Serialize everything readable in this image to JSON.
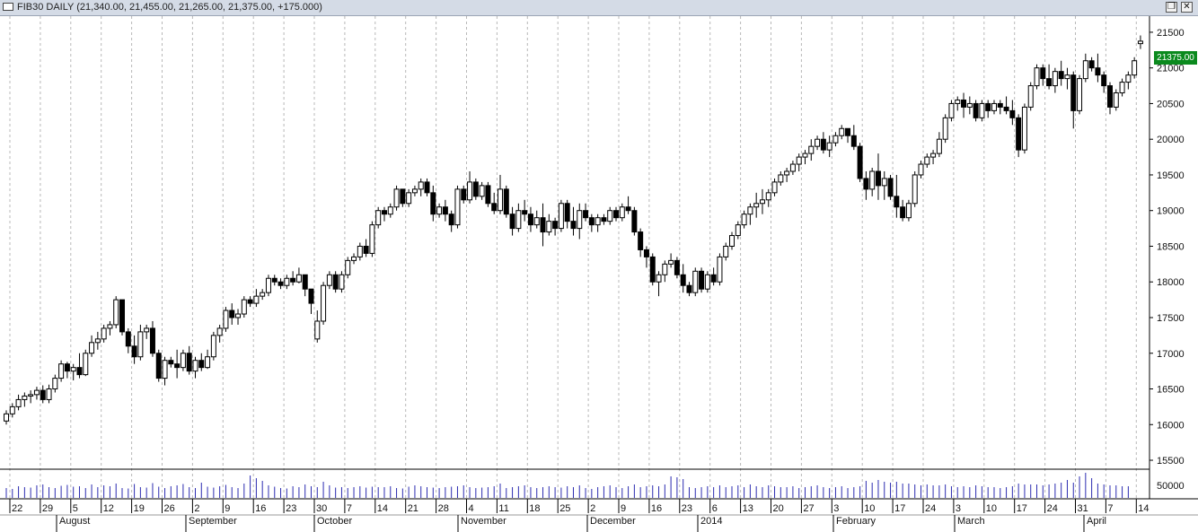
{
  "window": {
    "title": "FIB30 DAILY (21,340.00, 21,455.00, 21,265.00, 21,375.00, +175.000)",
    "restore_icon": "restore-icon",
    "close_icon": "close-icon"
  },
  "last_price_label": "21375.00",
  "colors": {
    "up_fill": "#ffffff",
    "down_fill": "#000000",
    "volume": "#2b2bb0",
    "grid": "#b8b8b8",
    "last_badge": "#0b8a1e"
  },
  "chart_data": {
    "type": "candlestick",
    "price_axis": {
      "ylim": [
        15450,
        21650
      ],
      "ticks": [
        15500,
        16000,
        16500,
        17000,
        17500,
        18000,
        18500,
        19000,
        19500,
        20000,
        20500,
        21000,
        21500
      ]
    },
    "volume_axis": {
      "ticks": [
        50000
      ]
    },
    "x_ticks": [
      "22",
      "29",
      "5",
      "12",
      "19",
      "26",
      "2",
      "9",
      "16",
      "23",
      "30",
      "7",
      "14",
      "21",
      "28",
      "4",
      "11",
      "18",
      "25",
      "2",
      "9",
      "16",
      "23",
      "6",
      "13",
      "20",
      "27",
      "3",
      "10",
      "17",
      "24",
      "3",
      "10",
      "17",
      "24",
      "31",
      "7",
      "14"
    ],
    "months": [
      "August",
      "September",
      "October",
      "November",
      "December",
      "2014",
      "February",
      "March",
      "April"
    ],
    "grid": true,
    "candles": [
      [
        16050,
        16200,
        16000,
        16150
      ],
      [
        16150,
        16300,
        16100,
        16250
      ],
      [
        16250,
        16420,
        16200,
        16350
      ],
      [
        16350,
        16450,
        16250,
        16400
      ],
      [
        16400,
        16480,
        16300,
        16420
      ],
      [
        16420,
        16530,
        16350,
        16480
      ],
      [
        16480,
        16550,
        16300,
        16350
      ],
      [
        16350,
        16560,
        16300,
        16500
      ],
      [
        16500,
        16700,
        16450,
        16650
      ],
      [
        16650,
        16900,
        16600,
        16850
      ],
      [
        16850,
        16880,
        16650,
        16750
      ],
      [
        16750,
        16850,
        16620,
        16800
      ],
      [
        16800,
        17000,
        16650,
        16700
      ],
      [
        16700,
        17050,
        16680,
        17000
      ],
      [
        17000,
        17250,
        16950,
        17150
      ],
      [
        17150,
        17300,
        17050,
        17200
      ],
      [
        17200,
        17400,
        17150,
        17350
      ],
      [
        17350,
        17450,
        17250,
        17400
      ],
      [
        17400,
        17800,
        17350,
        17750
      ],
      [
        17750,
        17750,
        17250,
        17300
      ],
      [
        17300,
        17350,
        17000,
        17100
      ],
      [
        17100,
        17250,
        16850,
        16950
      ],
      [
        16950,
        17400,
        16900,
        17300
      ],
      [
        17300,
        17400,
        17200,
        17350
      ],
      [
        17350,
        17450,
        16950,
        17000
      ],
      [
        17000,
        17050,
        16600,
        16650
      ],
      [
        16650,
        16950,
        16550,
        16900
      ],
      [
        16900,
        16950,
        16800,
        16850
      ],
      [
        16850,
        17050,
        16650,
        16800
      ],
      [
        16800,
        17050,
        16750,
        17000
      ],
      [
        17000,
        17100,
        16700,
        16750
      ],
      [
        16750,
        16950,
        16650,
        16900
      ],
      [
        16900,
        17000,
        16750,
        16800
      ],
      [
        16800,
        17050,
        16780,
        16950
      ],
      [
        16950,
        17300,
        16900,
        17250
      ],
      [
        17250,
        17400,
        17150,
        17350
      ],
      [
        17350,
        17650,
        17300,
        17600
      ],
      [
        17600,
        17700,
        17400,
        17500
      ],
      [
        17500,
        17620,
        17400,
        17550
      ],
      [
        17550,
        17800,
        17500,
        17750
      ],
      [
        17750,
        17800,
        17650,
        17700
      ],
      [
        17700,
        17900,
        17650,
        17800
      ],
      [
        17800,
        17900,
        17750,
        17850
      ],
      [
        17850,
        18100,
        17800,
        18050
      ],
      [
        18050,
        18100,
        17950,
        18000
      ],
      [
        18000,
        18050,
        17900,
        17950
      ],
      [
        17950,
        18100,
        17900,
        18050
      ],
      [
        18050,
        18150,
        17950,
        18000
      ],
      [
        18000,
        18200,
        17980,
        18100
      ],
      [
        18100,
        18100,
        17800,
        17900
      ],
      [
        17900,
        17900,
        17550,
        17700
      ],
      [
        17200,
        17600,
        17150,
        17450
      ],
      [
        17450,
        18000,
        17400,
        17950
      ],
      [
        17950,
        18150,
        17900,
        18100
      ],
      [
        18100,
        18150,
        17850,
        17900
      ],
      [
        17900,
        18150,
        17850,
        18100
      ],
      [
        18100,
        18350,
        18050,
        18300
      ],
      [
        18300,
        18400,
        18250,
        18350
      ],
      [
        18350,
        18550,
        18300,
        18500
      ],
      [
        18500,
        18600,
        18350,
        18400
      ],
      [
        18400,
        18850,
        18350,
        18800
      ],
      [
        18800,
        19050,
        18750,
        19000
      ],
      [
        19000,
        19050,
        18850,
        18950
      ],
      [
        18950,
        19100,
        18900,
        19050
      ],
      [
        19050,
        19350,
        19000,
        19300
      ],
      [
        19300,
        19300,
        19050,
        19100
      ],
      [
        19100,
        19300,
        19050,
        19250
      ],
      [
        19250,
        19350,
        19200,
        19300
      ],
      [
        19300,
        19450,
        19200,
        19400
      ],
      [
        19400,
        19450,
        19200,
        19250
      ],
      [
        19250,
        19350,
        18850,
        18950
      ],
      [
        18950,
        19100,
        18900,
        19050
      ],
      [
        19050,
        19150,
        18850,
        18950
      ],
      [
        18950,
        19000,
        18700,
        18800
      ],
      [
        18800,
        19350,
        18750,
        19300
      ],
      [
        19300,
        19350,
        19100,
        19150
      ],
      [
        19150,
        19550,
        19100,
        19400
      ],
      [
        19400,
        19450,
        19150,
        19200
      ],
      [
        19200,
        19400,
        19150,
        19350
      ],
      [
        19350,
        19400,
        19050,
        19100
      ],
      [
        19100,
        19250,
        18950,
        19000
      ],
      [
        19000,
        19500,
        18950,
        19300
      ],
      [
        19300,
        19350,
        18900,
        18950
      ],
      [
        18950,
        19050,
        18650,
        18750
      ],
      [
        18750,
        19100,
        18700,
        19000
      ],
      [
        19000,
        19150,
        18850,
        18950
      ],
      [
        18950,
        19050,
        18700,
        18800
      ],
      [
        18800,
        19000,
        18750,
        18900
      ],
      [
        18900,
        19100,
        18500,
        18700
      ],
      [
        18700,
        18950,
        18650,
        18850
      ],
      [
        18850,
        18900,
        18650,
        18750
      ],
      [
        18750,
        19150,
        18700,
        19100
      ],
      [
        19100,
        19150,
        18750,
        18850
      ],
      [
        18850,
        19050,
        18650,
        18750
      ],
      [
        18750,
        19100,
        18600,
        19000
      ],
      [
        19000,
        19100,
        18850,
        18900
      ],
      [
        18900,
        18950,
        18700,
        18800
      ],
      [
        18800,
        18950,
        18700,
        18900
      ],
      [
        18900,
        18950,
        18800,
        18850
      ],
      [
        18850,
        19050,
        18800,
        19000
      ],
      [
        19000,
        19050,
        18850,
        18900
      ],
      [
        18900,
        19100,
        18850,
        19050
      ],
      [
        19050,
        19200,
        18950,
        19000
      ],
      [
        19000,
        19050,
        18650,
        18700
      ],
      [
        18700,
        18750,
        18350,
        18450
      ],
      [
        18450,
        18500,
        18200,
        18350
      ],
      [
        18350,
        18400,
        17950,
        18000
      ],
      [
        18000,
        18150,
        17800,
        18100
      ],
      [
        18100,
        18300,
        18000,
        18250
      ],
      [
        18250,
        18400,
        18200,
        18300
      ],
      [
        18300,
        18350,
        18050,
        18100
      ],
      [
        18100,
        18250,
        17850,
        17950
      ],
      [
        17950,
        18000,
        17800,
        17850
      ],
      [
        17850,
        18200,
        17800,
        18150
      ],
      [
        18150,
        18200,
        17850,
        17900
      ],
      [
        17900,
        18150,
        17850,
        18100
      ],
      [
        18100,
        18200,
        17950,
        18000
      ],
      [
        18000,
        18400,
        17950,
        18350
      ],
      [
        18350,
        18550,
        18300,
        18500
      ],
      [
        18500,
        18700,
        18450,
        18650
      ],
      [
        18650,
        18850,
        18600,
        18800
      ],
      [
        18800,
        19000,
        18750,
        18950
      ],
      [
        18950,
        19100,
        18800,
        19050
      ],
      [
        19050,
        19250,
        18900,
        19100
      ],
      [
        19100,
        19300,
        18950,
        19150
      ],
      [
        19150,
        19300,
        19050,
        19250
      ],
      [
        19250,
        19450,
        19200,
        19400
      ],
      [
        19400,
        19550,
        19350,
        19500
      ],
      [
        19500,
        19600,
        19400,
        19550
      ],
      [
        19550,
        19700,
        19500,
        19650
      ],
      [
        19650,
        19800,
        19550,
        19750
      ],
      [
        19750,
        19850,
        19650,
        19800
      ],
      [
        19800,
        20000,
        19700,
        19900
      ],
      [
        19900,
        20050,
        19850,
        20000
      ],
      [
        20000,
        20100,
        19800,
        19850
      ],
      [
        19850,
        20050,
        19750,
        19950
      ],
      [
        19950,
        20100,
        19900,
        20050
      ],
      [
        20050,
        20200,
        20000,
        20150
      ],
      [
        20150,
        20150,
        19950,
        20050
      ],
      [
        20050,
        20200,
        19850,
        19900
      ],
      [
        19900,
        19950,
        19400,
        19450
      ],
      [
        19450,
        19550,
        19150,
        19300
      ],
      [
        19300,
        19600,
        19200,
        19550
      ],
      [
        19550,
        19800,
        19150,
        19350
      ],
      [
        19350,
        19550,
        19150,
        19450
      ],
      [
        19450,
        19500,
        19150,
        19200
      ],
      [
        19200,
        19500,
        18900,
        19050
      ],
      [
        19050,
        19150,
        18850,
        18900
      ],
      [
        18900,
        19150,
        18850,
        19100
      ],
      [
        19100,
        19550,
        19050,
        19500
      ],
      [
        19500,
        19700,
        19450,
        19650
      ],
      [
        19650,
        19800,
        19600,
        19750
      ],
      [
        19750,
        19850,
        19650,
        19800
      ],
      [
        19800,
        20100,
        19750,
        20000
      ],
      [
        20000,
        20350,
        19950,
        20300
      ],
      [
        20300,
        20550,
        20250,
        20500
      ],
      [
        20500,
        20600,
        20400,
        20550
      ],
      [
        20550,
        20650,
        20300,
        20450
      ],
      [
        20450,
        20600,
        20350,
        20500
      ],
      [
        20500,
        20550,
        20250,
        20300
      ],
      [
        20300,
        20550,
        20250,
        20500
      ],
      [
        20500,
        20550,
        20300,
        20400
      ],
      [
        20400,
        20550,
        20350,
        20500
      ],
      [
        20500,
        20550,
        20350,
        20450
      ],
      [
        20450,
        20600,
        20350,
        20400
      ],
      [
        20400,
        20550,
        20200,
        20300
      ],
      [
        20300,
        20350,
        19750,
        19850
      ],
      [
        19850,
        20500,
        19800,
        20450
      ],
      [
        20450,
        20800,
        20400,
        20750
      ],
      [
        20750,
        21050,
        20700,
        21000
      ],
      [
        21000,
        21050,
        20750,
        20850
      ],
      [
        20850,
        21050,
        20700,
        20750
      ],
      [
        20750,
        21000,
        20650,
        20950
      ],
      [
        20950,
        21100,
        20750,
        20850
      ],
      [
        20850,
        21000,
        20700,
        20900
      ],
      [
        20900,
        20950,
        20150,
        20400
      ],
      [
        20400,
        20900,
        20350,
        20850
      ],
      [
        20850,
        21200,
        20800,
        21100
      ],
      [
        21100,
        21150,
        20950,
        21000
      ],
      [
        21000,
        21200,
        20800,
        20900
      ],
      [
        20900,
        20950,
        20650,
        20750
      ],
      [
        20750,
        20800,
        20350,
        20450
      ],
      [
        20450,
        20700,
        20400,
        20650
      ],
      [
        20650,
        20850,
        20600,
        20800
      ],
      [
        20800,
        20950,
        20700,
        20900
      ],
      [
        20900,
        21150,
        20850,
        21100
      ],
      [
        21340,
        21455,
        21265,
        21375
      ]
    ],
    "volumes": [
      11000,
      10000,
      13000,
      12000,
      11500,
      14000,
      15000,
      12000,
      11000,
      13500,
      14500,
      12500,
      13000,
      11000,
      15000,
      12000,
      14000,
      13000,
      16000,
      11000,
      10500,
      15500,
      12000,
      11500,
      16500,
      12500,
      11000,
      13000,
      14000,
      15500,
      12000,
      11000,
      17000,
      12500,
      11500,
      13000,
      14500,
      12000,
      11000,
      16000,
      25000,
      22000,
      19000,
      14000,
      12500,
      11000,
      10500,
      13000,
      12000,
      15000,
      13000,
      12000,
      18000,
      14000,
      11500,
      12000,
      11000,
      12000,
      13000,
      11500,
      12500,
      12000,
      12000,
      13000,
      11000,
      10500,
      12500,
      14000,
      13000,
      12000,
      11500,
      11000,
      12000,
      12500,
      13000,
      14000,
      12000,
      11000,
      11500,
      12000,
      13000,
      16000,
      11000,
      12000,
      13000,
      14000,
      12000,
      11000,
      12000,
      13000,
      12000,
      11500,
      13000,
      12000,
      14000,
      11000,
      10000,
      12000,
      13000,
      14000,
      12000,
      11000,
      13000,
      15000,
      12000,
      13000,
      14000,
      13000,
      15000,
      24000,
      23000,
      21000,
      12000,
      11000,
      12000,
      13000,
      12000,
      14000,
      12000,
      13000,
      14000,
      12000,
      15000,
      13000,
      12000,
      14000,
      13000,
      12000,
      12000,
      13000,
      11000,
      12000,
      13000,
      14000,
      12000,
      11000,
      12000,
      13000,
      11000,
      12000,
      13000,
      19000,
      17000,
      20000,
      18000,
      17000,
      18000,
      16000,
      16000,
      15000,
      14000,
      15000,
      14000,
      14000,
      15000,
      13000,
      12000,
      13000,
      12000,
      14000,
      13000,
      12000,
      12000,
      11000,
      12000,
      13000,
      16000,
      15000,
      15000,
      15000,
      14000,
      15000,
      16000,
      17000,
      20000,
      17000,
      24000,
      28000,
      22000,
      16000,
      15000,
      14000,
      14000,
      13000,
      13000
    ]
  }
}
